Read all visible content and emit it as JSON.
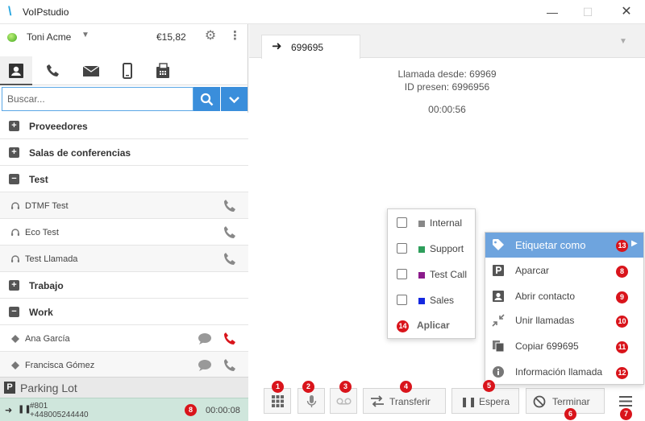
{
  "window": {
    "title": "VoIPstudio",
    "minimize": "—",
    "maximize": "☐",
    "close": "✕"
  },
  "account": {
    "name": "Toni Acme",
    "balance": "€15,82"
  },
  "tabs": [
    {
      "icon": "contacts-icon"
    },
    {
      "icon": "phone-icon"
    },
    {
      "icon": "mail-icon"
    },
    {
      "icon": "mobile-icon"
    },
    {
      "icon": "fax-icon"
    }
  ],
  "search": {
    "placeholder": "Buscar..."
  },
  "contact_groups": {
    "proveedores": {
      "label": "Proveedores",
      "toggle": "+"
    },
    "salas": {
      "label": "Salas de conferencias",
      "toggle": "+"
    },
    "test": {
      "label": "Test",
      "toggle": "−"
    },
    "trabajo": {
      "label": "Trabajo",
      "toggle": "+"
    },
    "work": {
      "label": "Work",
      "toggle": "−"
    }
  },
  "contacts": {
    "dtmf": "DTMF Test",
    "eco": "Eco Test",
    "testcall": "Test Llamada",
    "ana": "Ana García",
    "francisca": "Francisca Gómez"
  },
  "parking": {
    "badge": "P",
    "label": "Parking Lot"
  },
  "active_call": {
    "line1": "#801",
    "line2": "+448005244440",
    "timer": "00:00:08",
    "badge": "8"
  },
  "call": {
    "tab_number": "699695",
    "from_label": "Llamada desde: 69969",
    "id_label": "ID presen: 6996956",
    "timer": "00:00:56"
  },
  "buttons": {
    "keypad_badge": "1",
    "mic_badge": "2",
    "voicemail_badge": "3",
    "transfer": "Transferir",
    "transfer_badge": "4",
    "hold": "Espera",
    "hold_badge": "5",
    "hangup": "Terminar",
    "hangup_badge": "6",
    "menu_badge": "7"
  },
  "tag_menu": {
    "items": [
      {
        "label": "Internal",
        "color": "#888888"
      },
      {
        "label": "Support",
        "color": "#2e9e5b"
      },
      {
        "label": "Test Call",
        "color": "#8b1a8b"
      },
      {
        "label": "Sales",
        "color": "#1428e0"
      }
    ],
    "apply": "Aplicar",
    "apply_badge": "14"
  },
  "context_menu": {
    "tag": {
      "label": "Etiquetar como",
      "badge": "13"
    },
    "park": {
      "label": "Aparcar",
      "badge": "8"
    },
    "contact": {
      "label": "Abrir contacto",
      "badge": "9"
    },
    "merge": {
      "label": "Unir llamadas",
      "badge": "10"
    },
    "copy": {
      "label": "Copiar 699695",
      "badge": "11"
    },
    "info": {
      "label": "Información llamada",
      "badge": "12"
    }
  },
  "colors": {
    "accent": "#3a8edb",
    "badge": "#d9141b",
    "highlight": "#6ea4de",
    "active_call_bg": "#cfe6dc",
    "hangup_phone": "#d9141b"
  }
}
